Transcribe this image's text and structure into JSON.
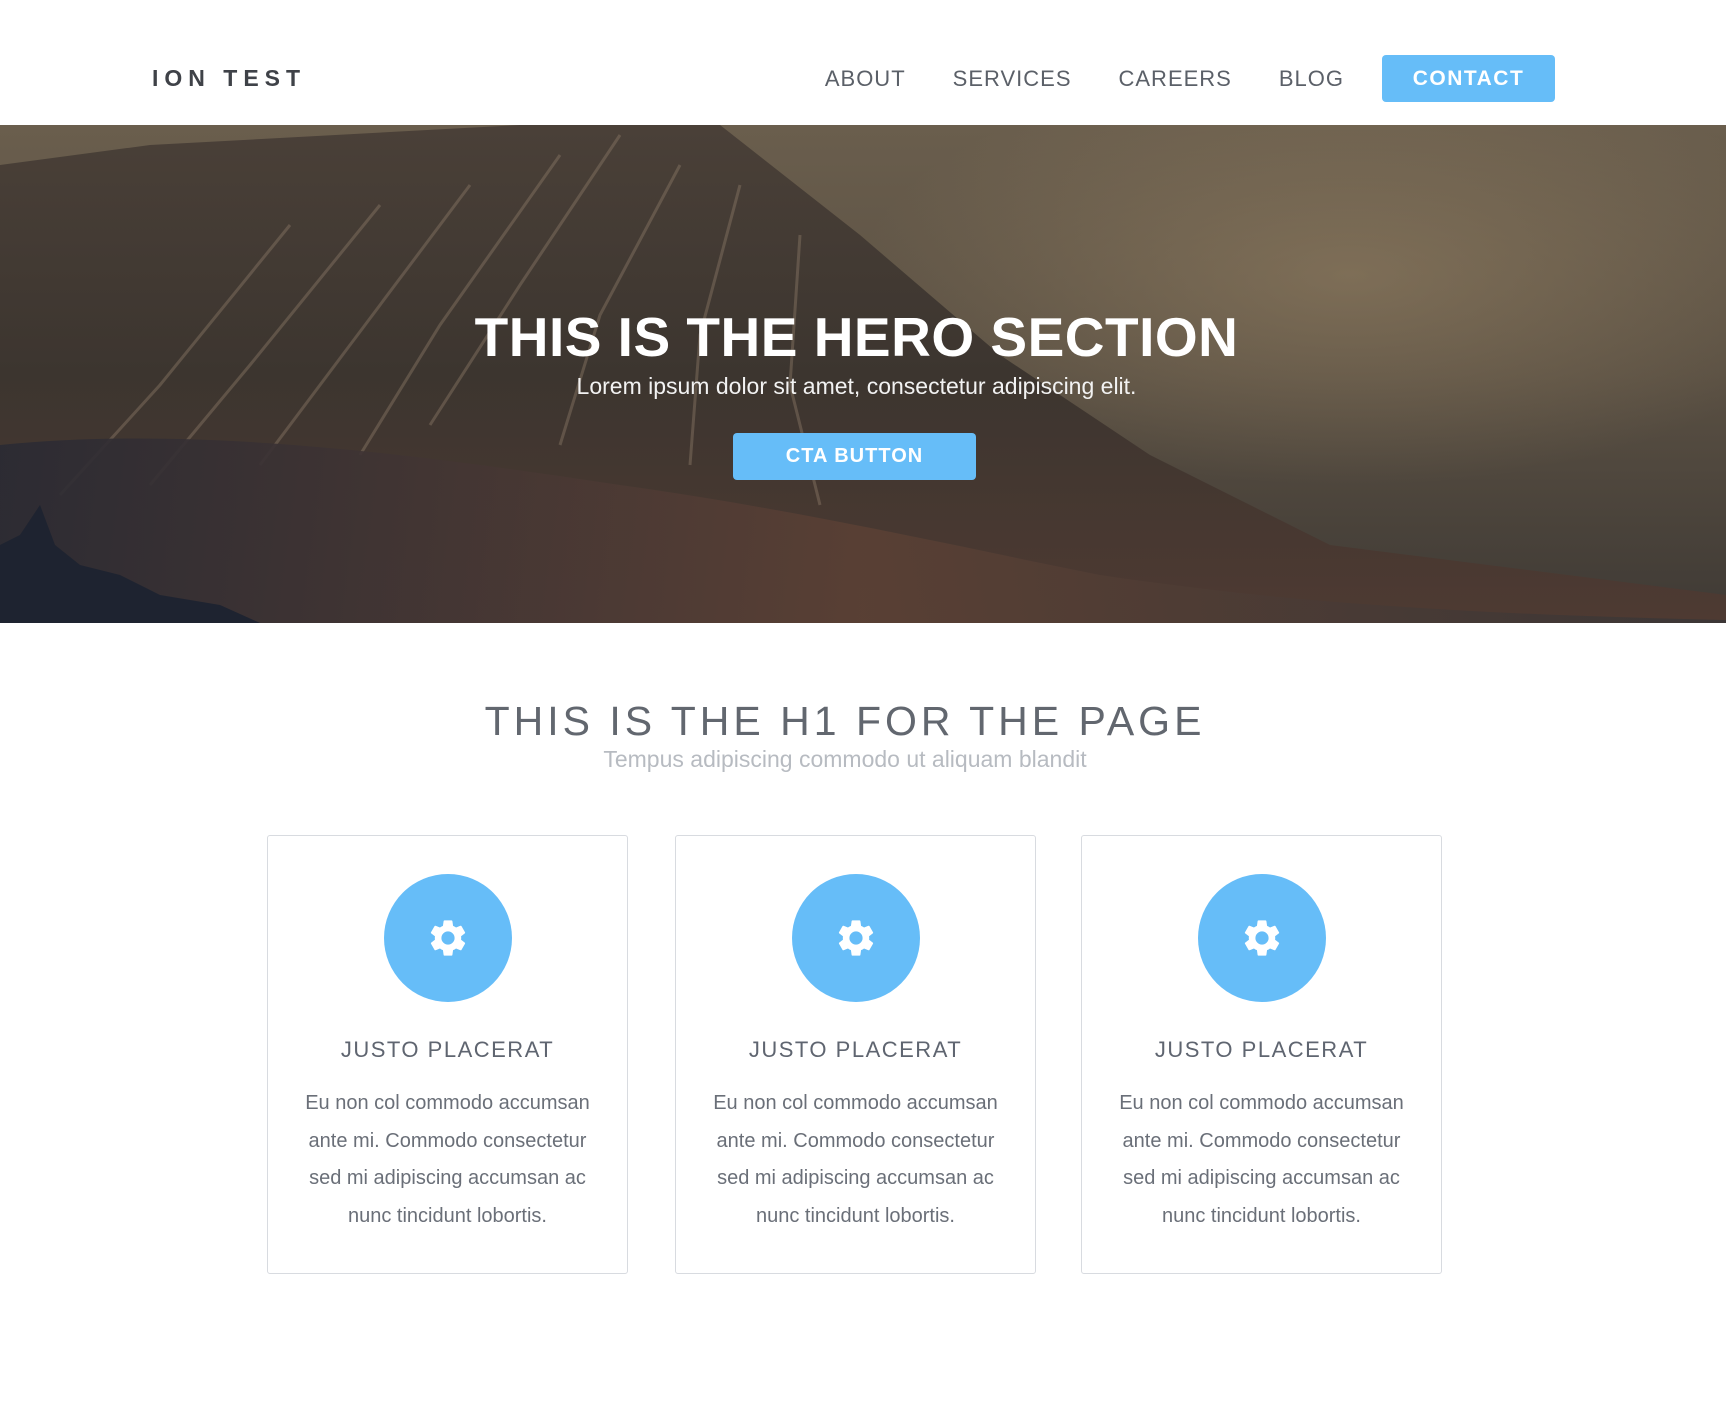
{
  "header": {
    "logo": "ION TEST",
    "nav": [
      {
        "label": "ABOUT"
      },
      {
        "label": "SERVICES"
      },
      {
        "label": "CAREERS"
      },
      {
        "label": "BLOG"
      }
    ],
    "cta_label": "CONTACT"
  },
  "hero": {
    "title": "THIS IS THE HERO SECTION",
    "subtitle": "Lorem ipsum dolor sit amet, consectetur adipiscing elit.",
    "button_label": "CTA BUTTON"
  },
  "main": {
    "title": "THIS IS THE H1 FOR THE PAGE",
    "subtitle": "Tempus adipiscing commodo ut aliquam blandit",
    "cards": [
      {
        "icon": "gear-icon",
        "title": "JUSTO PLACERAT",
        "text": "Eu non col commodo accumsan ante mi. Commodo consectetur sed mi adipiscing accumsan ac nunc tincidunt lobortis."
      },
      {
        "icon": "gear-icon",
        "title": "JUSTO PLACERAT",
        "text": "Eu non col commodo accumsan ante mi. Commodo consectetur sed mi adipiscing accumsan ac nunc tincidunt lobortis."
      },
      {
        "icon": "gear-icon",
        "title": "JUSTO PLACERAT",
        "text": "Eu non col commodo accumsan ante mi. Commodo consectetur sed mi adipiscing accumsan ac nunc tincidunt lobortis."
      }
    ]
  },
  "colors": {
    "accent": "#66bdf8",
    "heading": "#62676f",
    "muted": "#b7bbc1"
  }
}
